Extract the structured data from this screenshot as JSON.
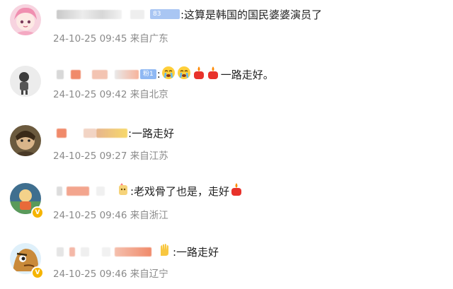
{
  "comments": [
    {
      "text": ":这算是韩国的国民婆婆演员了",
      "fan_badge": "",
      "timestamp": "24-10-25 09:45",
      "location": "来自广东",
      "avatar": "pink-anime-avatar"
    },
    {
      "text": "一路走好。",
      "fan_badge": "粉1",
      "timestamp": "24-10-25 09:42",
      "location": "来自北京",
      "avatar": "gray-silhouette-avatar"
    },
    {
      "text": ":一路走好",
      "fan_badge": "",
      "timestamp": "24-10-25 09:27",
      "location": "来自江苏",
      "avatar": "portrait-photo-avatar"
    },
    {
      "text": ":老戏骨了也是，走好",
      "fan_badge": "",
      "timestamp": "24-10-25 09:46",
      "location": "来自浙江",
      "avatar": "cartoon-avatar"
    },
    {
      "text": ":一路走好",
      "fan_badge": "",
      "timestamp": "24-10-25 09:46",
      "location": "来自辽宁",
      "avatar": "cartoon-face-avatar"
    }
  ],
  "colors": {
    "meta_text": "#8a8a8a",
    "body_text": "#222222",
    "fan_badge": "#8fb8f3",
    "verified_badge": "#f5b400"
  }
}
